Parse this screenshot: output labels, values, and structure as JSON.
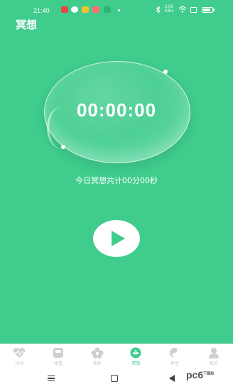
{
  "status_bar": {
    "time": "21:40",
    "net_speed_top": "2.00",
    "net_speed_bottom": "KB/s"
  },
  "header": {
    "title": "冥想"
  },
  "meditation": {
    "timer": "00:00:00",
    "summary": "今日冥想共计00分00秒"
  },
  "tabs": [
    {
      "label": "运动",
      "icon": "heart-pulse-icon"
    },
    {
      "label": "体重",
      "icon": "scale-icon"
    },
    {
      "label": "营养",
      "icon": "flower-icon"
    },
    {
      "label": "冥想",
      "icon": "lotus-icon",
      "active": true
    },
    {
      "label": "养生",
      "icon": "yin-yang-icon"
    },
    {
      "label": "我的",
      "icon": "user-icon"
    }
  ],
  "watermark": {
    "text": "pc6",
    "sub": "下载站"
  },
  "colors": {
    "primary": "#3fcc8d",
    "inactive": "#c8c8c8"
  }
}
